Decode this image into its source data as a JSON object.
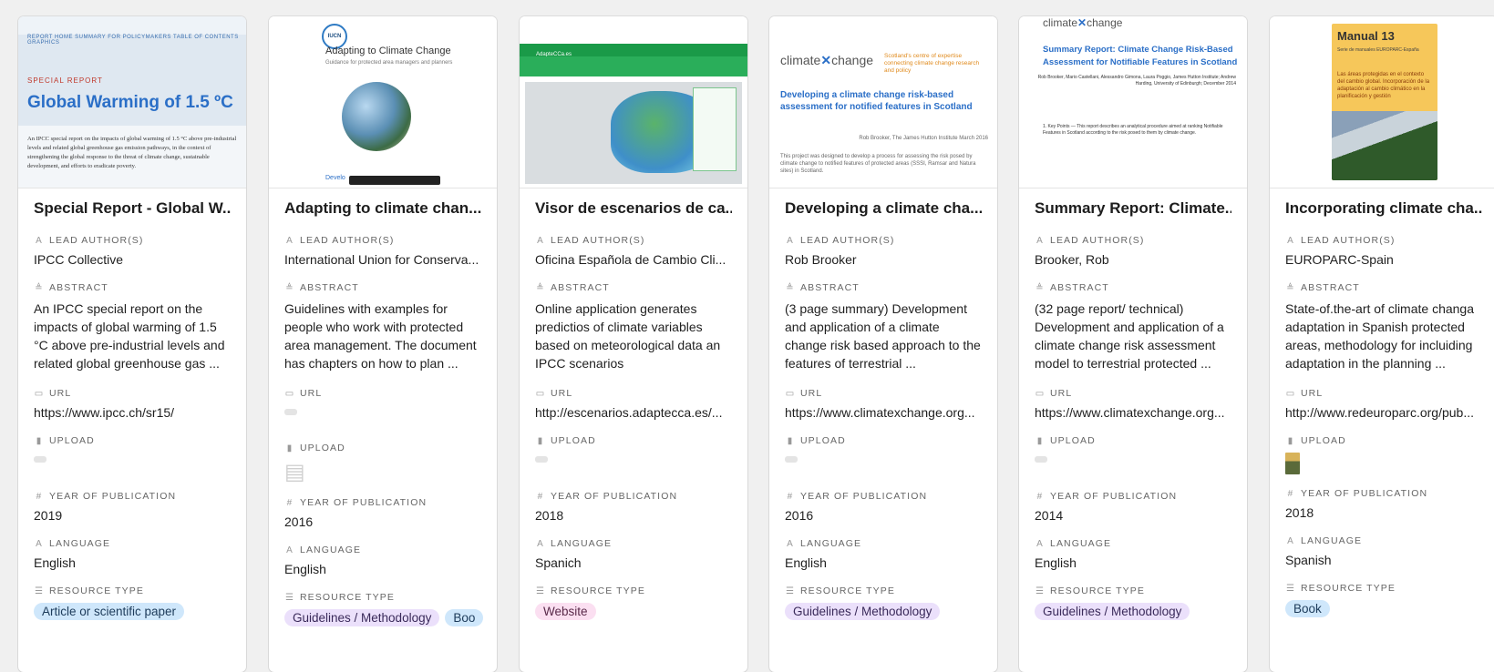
{
  "field_labels": {
    "author": "LEAD AUTHOR(S)",
    "abstract": "ABSTRACT",
    "url": "URL",
    "upload": "UPLOAD",
    "year": "YEAR OF PUBLICATION",
    "language": "LANGUAGE",
    "type": "RESOURCE TYPE"
  },
  "field_icons": {
    "author": "text-field-icon",
    "abstract": "long-text-icon",
    "url": "url-icon",
    "upload": "attachment-icon",
    "year": "number-icon",
    "language": "text-field-icon",
    "type": "multi-select-icon"
  },
  "tag_colors": {
    "blue": "#cfe7fb",
    "purple": "#ebe0fb",
    "pink": "#fbdff1"
  },
  "cards": [
    {
      "cover": {
        "nav": "REPORT HOME   SUMMARY FOR POLICYMAKERS   TABLE OF CONTENTS   GRAPHICS",
        "kicker": "SPECIAL REPORT",
        "headline": "Global Warming of 1.5 ºC",
        "text": "An IPCC special report on the impacts of global warming of 1.5 °C above pre-industrial levels and related global greenhouse gas emission pathways, in the context of strengthening the global response to the threat of climate change, sustainable development, and efforts to eradicate poverty."
      },
      "title": "Special Report - Global W...",
      "author": "IPCC Collective",
      "abstract": "An IPCC special report on the impacts of global warming of 1.5 °C above pre-industrial levels and related global greenhouse gas ...",
      "url": "https://www.ipcc.ch/sr15/",
      "year": "2019",
      "language": "English",
      "types": [
        {
          "label": "Article or scientific paper",
          "color": "blue"
        }
      ]
    },
    {
      "cover": {
        "org": "IUCN",
        "headline": "Adapting to Climate Change",
        "subtitle": "Guidance for protected area managers and planners",
        "footer": "Develo"
      },
      "title": "Adapting to climate chan...",
      "author": "International Union for Conserva...",
      "abstract": "Guidelines with examples for people who work with protected area management. The document has chapters on how to plan ...",
      "url": "",
      "year": "2016",
      "language": "English",
      "types": [
        {
          "label": "Guidelines / Methodology",
          "color": "purple"
        },
        {
          "label": "Boo",
          "color": "blue"
        }
      ]
    },
    {
      "cover": {
        "brand": "AdapteCCa.es"
      },
      "title": "Visor de escenarios de ca...",
      "author": "Oficina Española de Cambio Cli...",
      "abstract": "Online application generates predictios of climate variables based on meteorological data an IPCC scenarios",
      "url": "http://escenarios.adaptecca.es/...",
      "year": "2018",
      "language": "Spanich",
      "types": [
        {
          "label": "Website",
          "color": "pink"
        }
      ]
    },
    {
      "cover": {
        "logo_a": "climate",
        "logo_b": "change",
        "tagline": "Scotland's centre of expertise connecting climate change research and policy",
        "headline": "Developing a climate change risk-based assessment for notified features in Scotland",
        "byline": "Rob Brooker, The James Hutton Institute March 2016",
        "aim": "This project was designed to develop a process for assessing the risk posed by climate change to notified features of protected areas (SSSI, Ramsar and Natura sites) in Scotland."
      },
      "title": "Developing a climate cha...",
      "author": "Rob Brooker",
      "abstract": "(3 page summary) Development and application of a climate change risk based approach to the features of terrestrial ...",
      "url": "https://www.climatexchange.org...",
      "year": "2016",
      "language": "English",
      "types": [
        {
          "label": "Guidelines / Methodology",
          "color": "purple"
        }
      ]
    },
    {
      "cover": {
        "logo_a": "climate",
        "logo_b": "change",
        "headline": "Summary Report: Climate Change Risk-Based Assessment for Notifiable Features in Scotland",
        "authors": "Rob Brooker, Mario Castellani, Alessandro Gimona, Laura Poggio, James Hutton Institute; Andrew Harding, University of Edinburgh; December 2014",
        "keypoints": "1. Key Points — This report describes an analytical procedure aimed at ranking Notifiable Features in Scotland according to the risk posed to them by climate change."
      },
      "title": "Summary Report: Climate...",
      "author": "Brooker, Rob",
      "abstract": "(32 page report/ technical) Development and application of a climate change risk assessment model to terrestrial protected ...",
      "url": "https://www.climatexchange.org...",
      "year": "2014",
      "language": "English",
      "types": [
        {
          "label": "Guidelines / Methodology",
          "color": "purple"
        }
      ]
    },
    {
      "cover": {
        "headline": "Manual 13",
        "subtitle": "Serie de manuales EUROPARC-España",
        "title2": "Las áreas protegidas en el contexto del cambio global. Incorporación de la adaptación al cambio climático en la planificación y gestión"
      },
      "title": "Incorporating climate cha...",
      "author": "EUROPARC-Spain",
      "abstract": "State-of.the-art of climate changa adaptation in Spanish protected areas, methodology for incluiding adaptation in the planning ...",
      "url": "http://www.redeuroparc.org/pub...",
      "year": "2018",
      "language": "Spanish",
      "types": [
        {
          "label": "Book",
          "color": "blue"
        }
      ]
    }
  ]
}
